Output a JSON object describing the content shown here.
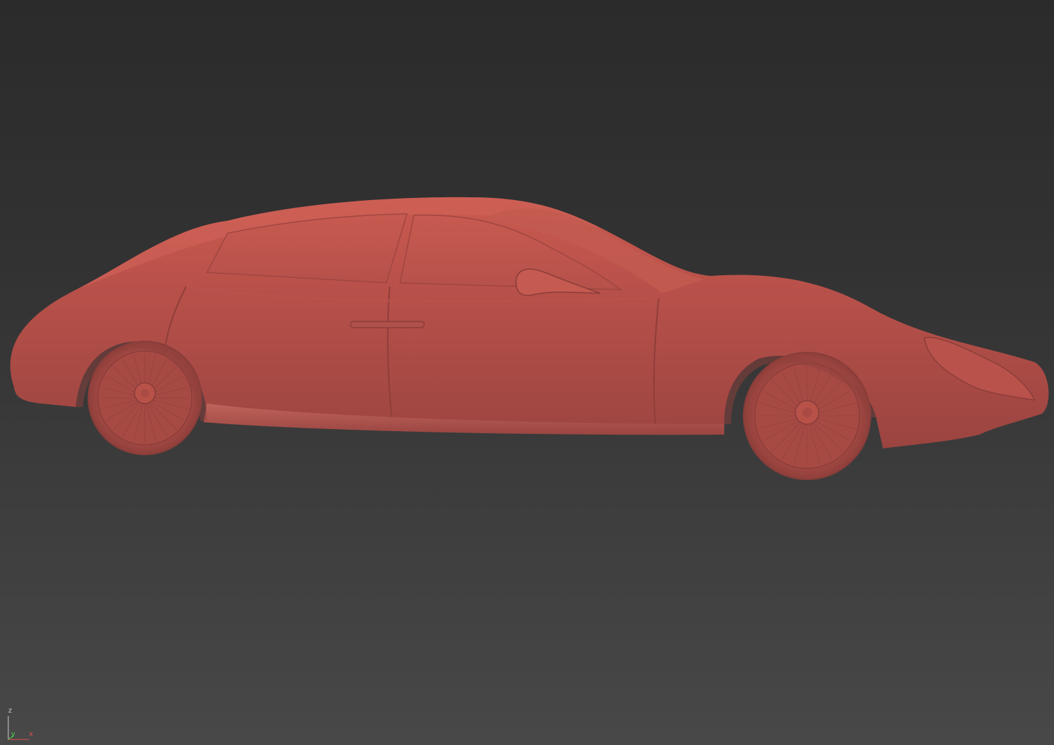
{
  "viewport": {
    "background_top": "#2b2b2b",
    "background_bottom": "#484848"
  },
  "model": {
    "icon": "car-model",
    "clay_color": "#c4564c"
  },
  "axis_gizmo": {
    "z_label": "z",
    "y_label": "y",
    "x_label": "x",
    "colors": {
      "z": "#cfcfcf",
      "y": "#4fd24f",
      "x": "#e05050"
    }
  }
}
